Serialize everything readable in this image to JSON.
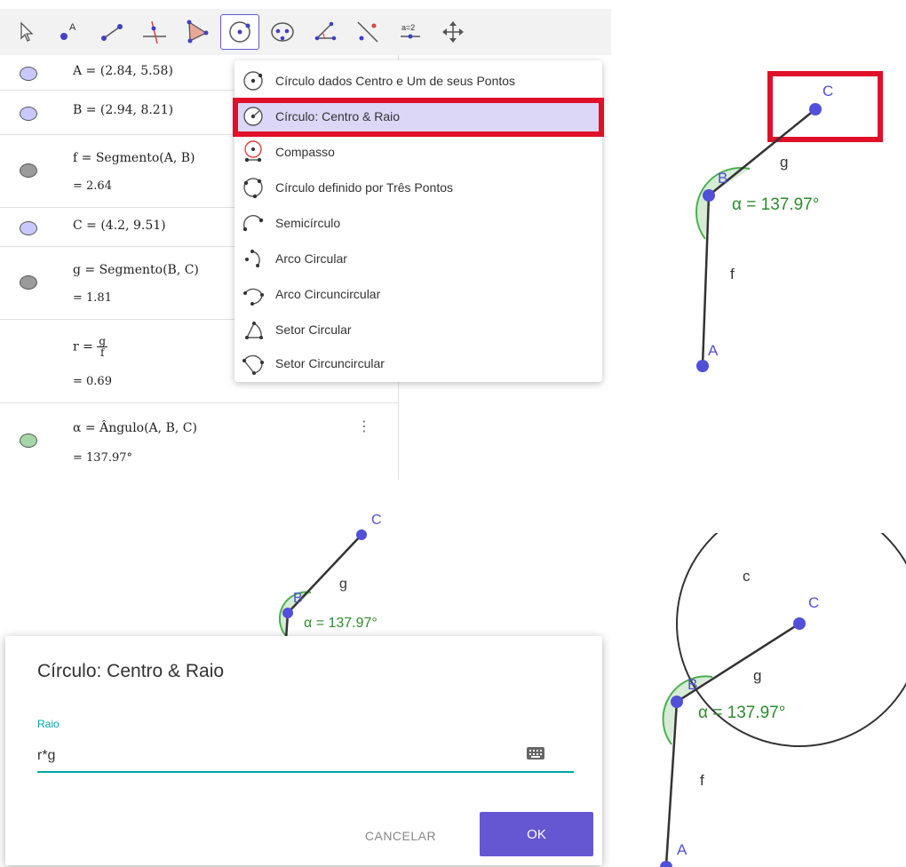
{
  "algebra": {
    "rows": [
      {
        "expr": "A = (2.84, 5.58)",
        "color": "#c8c8ff"
      },
      {
        "expr": "B = (2.94, 8.21)",
        "color": "#c8c8ff"
      },
      {
        "expr": "f = Segmento(A, B)",
        "val": "= 2.64",
        "color": "#9a9a9a"
      },
      {
        "expr": "C = (4.2, 9.51)",
        "color": "#c8c8ff"
      },
      {
        "expr": "g = Segmento(B, C)",
        "val": "= 1.81",
        "color": "#9a9a9a"
      },
      {
        "expr_lhs": "r =",
        "num": "g",
        "den": "f",
        "val": "= 0.69"
      },
      {
        "expr": "α = Ângulo(A, B, C)",
        "val": "= 137.97°",
        "color": "#a5d6a7"
      }
    ]
  },
  "menu": {
    "items": [
      "Círculo dados Centro e Um de seus Pontos",
      "Círculo: Centro & Raio",
      "Compasso",
      "Círculo definido por Três Pontos",
      "Semicírculo",
      "Arco Circular",
      "Arco Circuncircular",
      "Setor Circular",
      "Setor Circuncircular"
    ]
  },
  "geo": {
    "point_a": "A",
    "point_b": "B",
    "point_c": "C",
    "seg_f": "f",
    "seg_g": "g",
    "circle_c": "c",
    "angle_label": "α = 137.97°"
  },
  "toolbar": {
    "equal_label": "a=2"
  },
  "dialog": {
    "title": "Círculo: Centro & Raio",
    "field_label": "Raio",
    "field_value": "r*g",
    "cancel": "CANCELAR",
    "ok": "OK"
  },
  "colors": {
    "accent": "#6557d2",
    "highlight": "#e0102a",
    "point": "#5050d8",
    "angle": "#4caf50",
    "teal": "#00a8a8"
  }
}
